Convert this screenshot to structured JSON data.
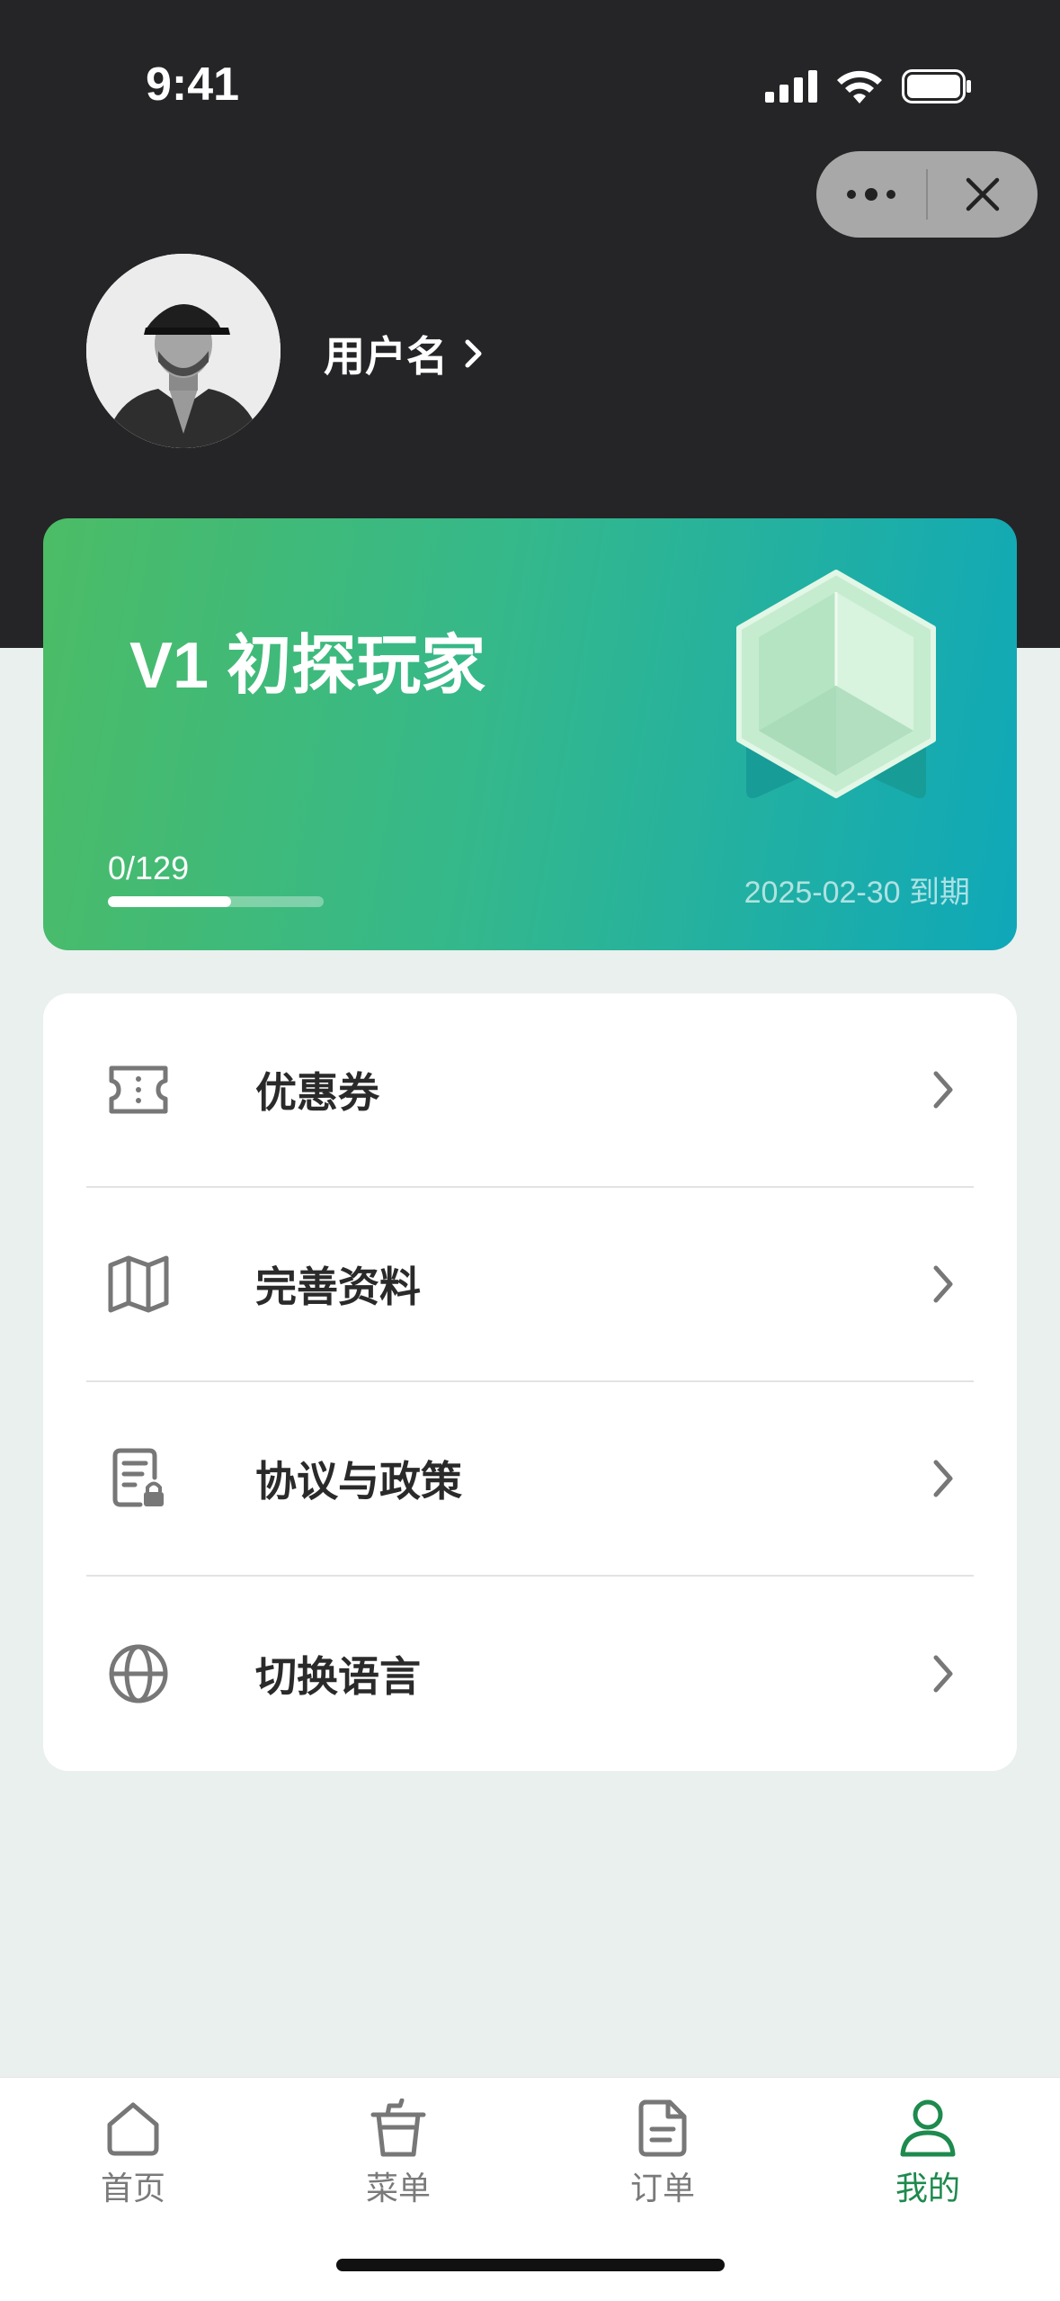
{
  "status_bar": {
    "time": "9:41"
  },
  "profile": {
    "username": "用户名"
  },
  "member_card": {
    "level_title": "V1 初探玩家",
    "progress_text": "0/129",
    "progress_fraction": 0.57,
    "expiry": "2025-02-30 到期",
    "gradient_start": "#4cbc66",
    "gradient_end": "#0fa8b9"
  },
  "menu": {
    "items": [
      {
        "label": "优惠券",
        "icon": "ticket-icon"
      },
      {
        "label": "完善资料",
        "icon": "map-icon"
      },
      {
        "label": "协议与政策",
        "icon": "document-lock-icon"
      },
      {
        "label": "切换语言",
        "icon": "globe-icon"
      }
    ]
  },
  "tabbar": {
    "tabs": [
      {
        "label": "首页",
        "icon": "home-icon"
      },
      {
        "label": "菜单",
        "icon": "cup-icon"
      },
      {
        "label": "订单",
        "icon": "order-document-icon"
      },
      {
        "label": "我的",
        "icon": "user-icon",
        "active": true
      }
    ],
    "active_color": "#1e8a4e",
    "inactive_color": "#7a7a7a"
  }
}
